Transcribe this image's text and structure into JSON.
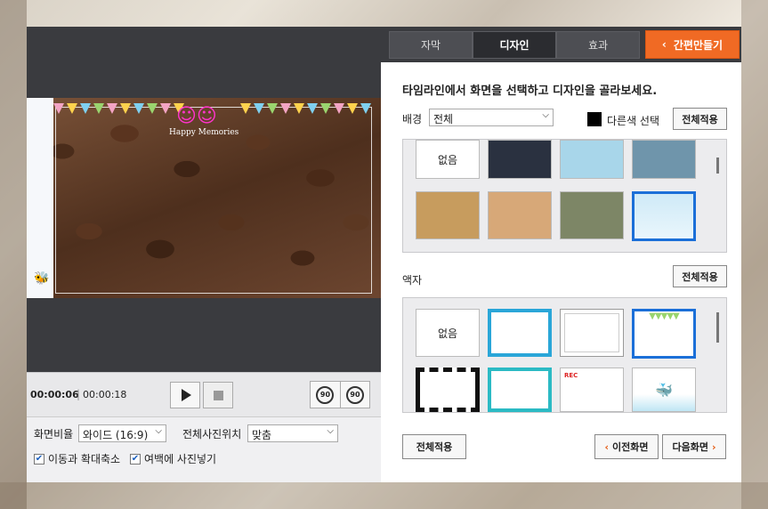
{
  "preview": {
    "overlay_text": "Happy Memories",
    "time_current": "00:00:06",
    "time_separator": "|",
    "time_total": "00:00:18",
    "rotate_left_label": "90",
    "rotate_right_label": "90"
  },
  "settings": {
    "aspect_label": "화면비율",
    "aspect_value": "와이드 (16:9)",
    "photo_pos_label": "전체사진위치",
    "photo_pos_value": "맞춤",
    "move_zoom_label": "이동과 확대축소",
    "margin_fill_label": "여백에 사진넣기"
  },
  "tabs": [
    {
      "label": "자막"
    },
    {
      "label": "디자인"
    },
    {
      "label": "효과"
    }
  ],
  "quick_make": {
    "arrow": "‹",
    "label": "간편만들기"
  },
  "design": {
    "instruction": "타임라인에서 화면을 선택하고 디자인을 골라보세요.",
    "background_label": "배경",
    "background_select": "전체",
    "other_color_label": "다른색 선택",
    "apply_all_label": "전체적용",
    "frame_label": "액자",
    "none_label": "없음",
    "rec_label": "REC"
  },
  "footer": {
    "apply_all_label": "전체적용",
    "prev_label": "이전화면",
    "next_label": "다음화면",
    "prev_arrow": "‹",
    "next_arrow": "›"
  },
  "colors": {
    "accent_orange": "#f06a24",
    "selection_blue": "#1b6fd8",
    "dark_panel": "#2f3034"
  }
}
